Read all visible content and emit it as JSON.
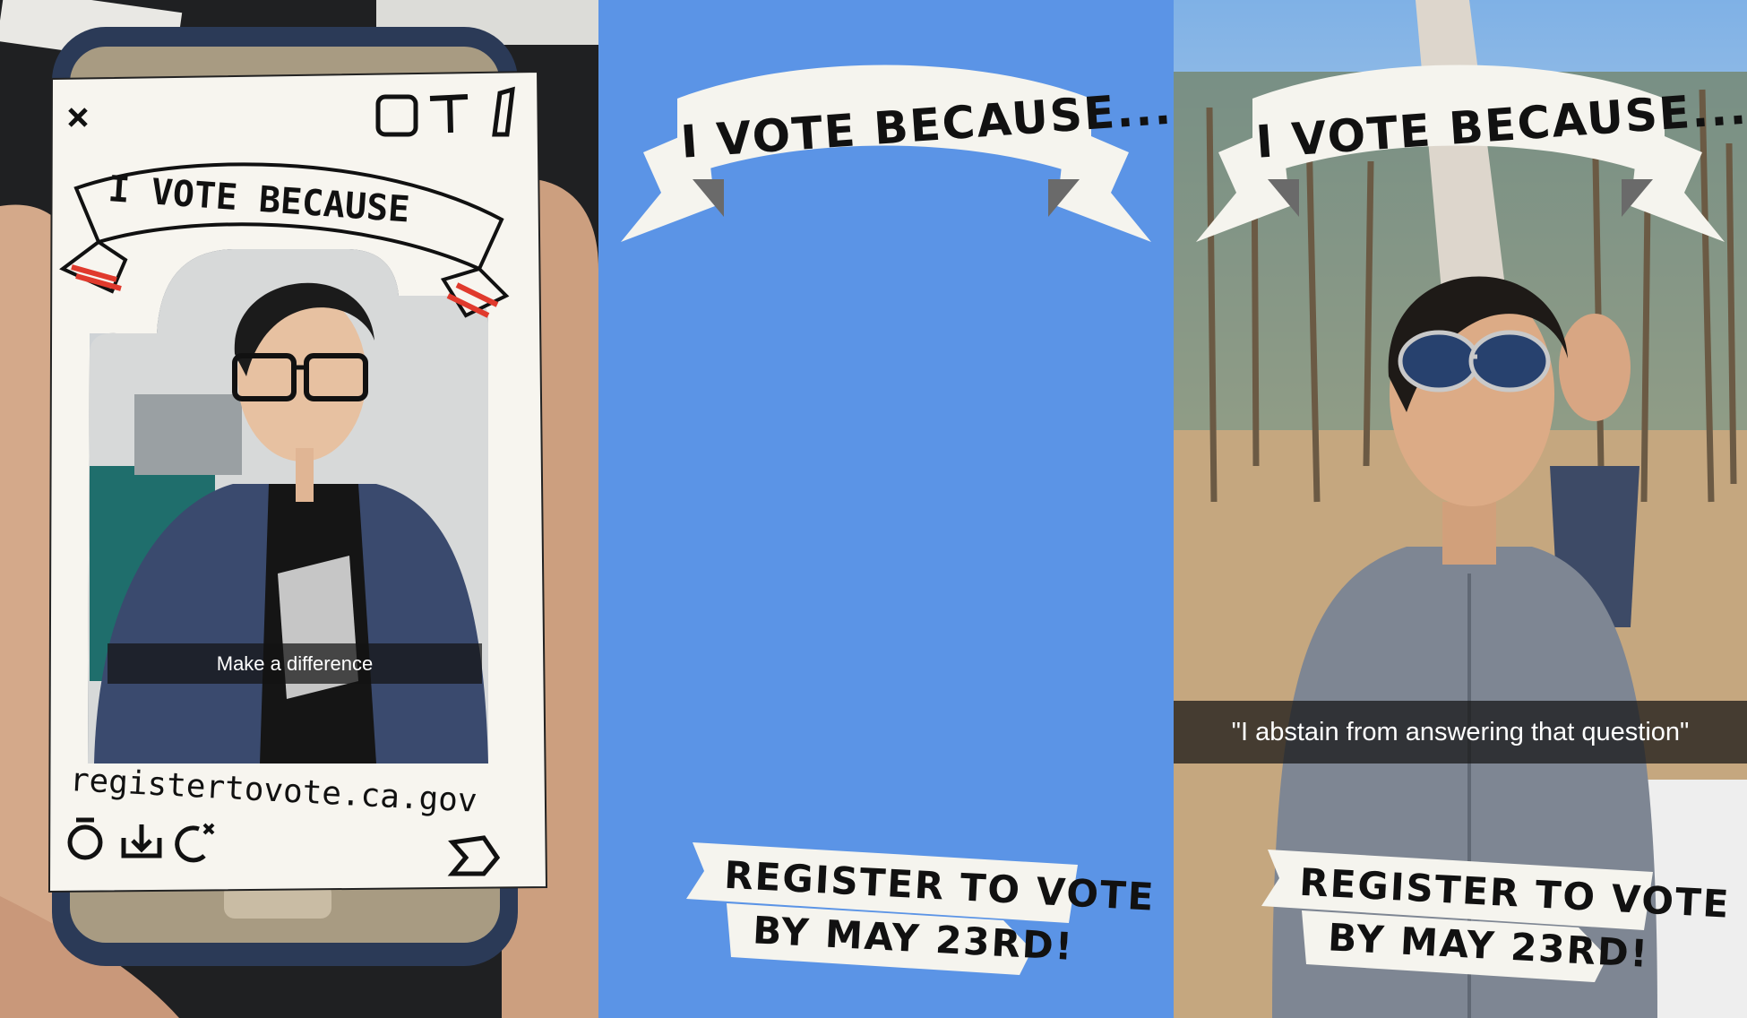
{
  "left_panel": {
    "banner_text": "I VOTE BECAUSE",
    "caption": "Make a difference",
    "url": "registertovote.ca.gov",
    "icons": {
      "close": "close-icon",
      "top_right": [
        "sticker-icon",
        "text-icon",
        "pencil-icon"
      ],
      "bottom_left": [
        "timer-icon",
        "download-icon",
        "add-story-icon"
      ],
      "bottom_right": "send-icon"
    }
  },
  "middle_panel": {
    "background_color": "#5b94e6",
    "banner_text": "I VOTE BECAUSE...",
    "footer_line1": "REGISTER TO VOTE",
    "footer_line2": "BY MAY 23RD!"
  },
  "right_panel": {
    "banner_text": "I VOTE BECAUSE...",
    "caption": "\"I abstain from answering that question\"",
    "footer_line1": "REGISTER TO VOTE",
    "footer_line2": "BY MAY 23RD!"
  },
  "colors": {
    "ribbon": "#f5f4ee",
    "ribbon_shadow": "#6a6a6a",
    "paper": "#f7f5ef",
    "phone_case": "#2b3a57",
    "accent_red": "#e03a2d"
  }
}
